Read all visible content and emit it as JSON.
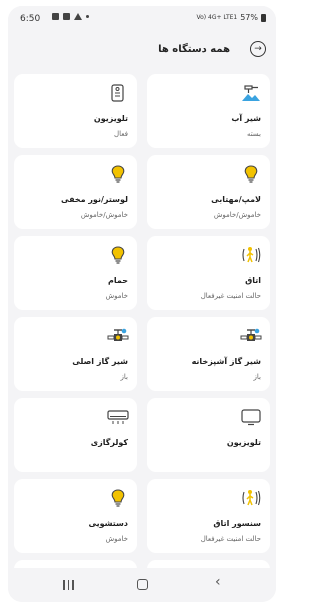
{
  "status_bar": {
    "time": "6:50",
    "battery_text": "57%",
    "network_text": "Vo) 4G+ LTE1"
  },
  "header": {
    "title": "همه دستگاه ها",
    "back_icon": "arrow-right-circle-icon"
  },
  "devices": [
    {
      "name": "شیر آب",
      "status": "بسته",
      "icon": "water-valve-icon"
    },
    {
      "name": "تلویزیون",
      "status": "فعال",
      "icon": "tv-remote-icon"
    },
    {
      "name": "لامپ/مهتابی",
      "status": "خاموش/خاموش",
      "icon": "lightbulb-icon"
    },
    {
      "name": "لوستر/نور مخفی",
      "status": "خاموش/خاموش",
      "icon": "lightbulb-icon"
    },
    {
      "name": "اتاق",
      "status": "حالت امنیت غیرفعال",
      "icon": "motion-sensor-icon"
    },
    {
      "name": "حمام",
      "status": "خاموش",
      "icon": "lightbulb-icon"
    },
    {
      "name": "شیر گاز آشپزخانه",
      "status": "باز",
      "icon": "gas-valve-icon"
    },
    {
      "name": "شیر گاز اصلی",
      "status": "باز",
      "icon": "gas-valve-icon"
    },
    {
      "name": "تلویزیون",
      "status": "",
      "icon": "tv-icon"
    },
    {
      "name": "کولرگازی",
      "status": "",
      "icon": "air-conditioner-icon"
    },
    {
      "name": "سنسور اتاق",
      "status": "حالت امنیت غیرفعال",
      "icon": "motion-sensor-icon"
    },
    {
      "name": "دستشویی",
      "status": "خاموش",
      "icon": "lightbulb-icon"
    }
  ],
  "colors": {
    "accent_yellow": "#f2c200",
    "accent_blue": "#3aa3e0",
    "background": "#f4f4f6",
    "card": "#ffffff"
  }
}
